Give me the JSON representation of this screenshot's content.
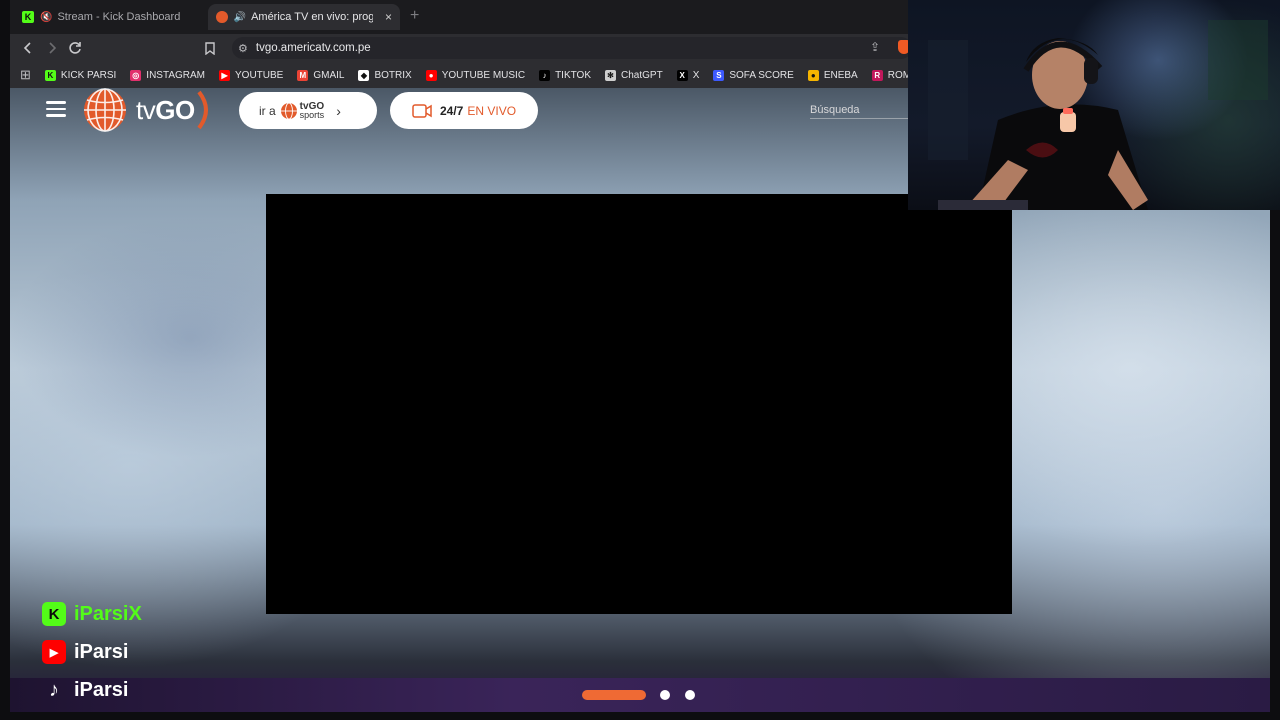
{
  "browser": {
    "tabs": [
      {
        "title": "Stream - Kick Dashboard",
        "favicon": "kick-icon",
        "muted": true,
        "active": false
      },
      {
        "title": "América TV en vivo: program",
        "favicon": "americatv-icon",
        "muted": false,
        "active": true
      }
    ],
    "new_tab_glyph": "+",
    "close_glyph": "×",
    "url": "tvgo.americatv.com.pe",
    "bookmarks": [
      {
        "label": "KICK PARSI",
        "icon": "kick-icon",
        "color": "#53fc18"
      },
      {
        "label": "INSTAGRAM",
        "icon": "instagram-icon",
        "color": "#e1306c"
      },
      {
        "label": "YOUTUBE",
        "icon": "youtube-icon",
        "color": "#ff0000"
      },
      {
        "label": "GMAIL",
        "icon": "gmail-icon",
        "color": "#ea4335"
      },
      {
        "label": "BOTRIX",
        "icon": "botrix-icon",
        "color": "#ffffff"
      },
      {
        "label": "YOUTUBE MUSIC",
        "icon": "youtube-music-icon",
        "color": "#ff0000"
      },
      {
        "label": "TIKTOK",
        "icon": "tiktok-icon",
        "color": "#000000"
      },
      {
        "label": "ChatGPT",
        "icon": "chatgpt-icon",
        "color": "#cfcfcf"
      },
      {
        "label": "X",
        "icon": "x-icon",
        "color": "#000000"
      },
      {
        "label": "SOFA SCORE",
        "icon": "sofascore-icon",
        "color": "#3d5afe"
      },
      {
        "label": "ENEBA",
        "icon": "eneba-icon",
        "color": "#f5b400"
      },
      {
        "label": "ROMSFUN",
        "icon": "romsfun-icon",
        "color": "#c2185b"
      }
    ]
  },
  "site": {
    "logo_text_a": "tv",
    "logo_text_b": "GO",
    "sports_button": {
      "prefix": "ir a",
      "brand_top": "tvGO",
      "brand_bottom": "sports"
    },
    "live_button": {
      "part_a": "24/7",
      "part_b": "EN VIVO"
    },
    "search_placeholder": "Búsqueda",
    "accent_color": "#ef6a34"
  },
  "carousel": {
    "total": 3,
    "active_index": 0
  },
  "socials": [
    {
      "platform": "kick",
      "icon": "kick-icon",
      "name": "iParsiX",
      "color": "#53fc18"
    },
    {
      "platform": "youtube",
      "icon": "youtube-icon",
      "name": "iParsi",
      "color": "#ffffff"
    },
    {
      "platform": "tiktok",
      "icon": "tiktok-icon",
      "name": "iParsi",
      "color": "#ffffff"
    }
  ]
}
